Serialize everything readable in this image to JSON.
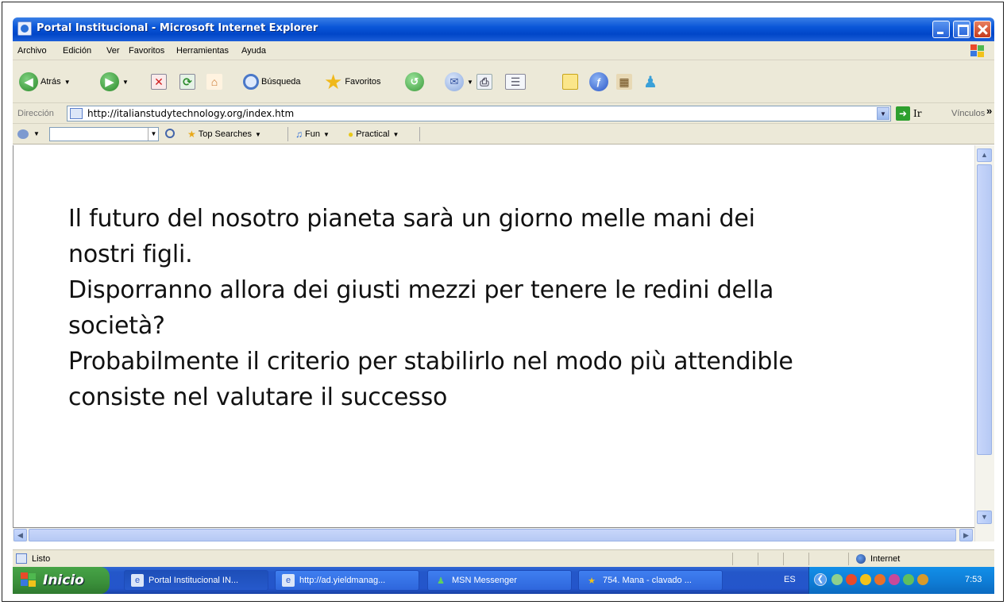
{
  "window": {
    "title": "Portal Institucional  - Microsoft Internet Explorer"
  },
  "menu": {
    "items": [
      "Archivo",
      "Edición",
      "Ver",
      "Favoritos",
      "Herramientas",
      "Ayuda"
    ]
  },
  "toolbar": {
    "back_label": "Atrás",
    "search_label": "Búsqueda",
    "favorites_label": "Favoritos"
  },
  "address": {
    "label": "Dirección",
    "url": "http://italianstudytechnology.org/index.htm",
    "go_label": "Ir",
    "links_label": "Vínculos"
  },
  "linksbar": {
    "top_searches": "Top Searches",
    "fun": "Fun",
    "practical": "Practical"
  },
  "page": {
    "lines": [
      "Il futuro del nosotro pianeta sarà un giorno melle mani dei",
      "nostri figli.",
      "Disporranno allora dei giusti mezzi per tenere le redini della",
      "società?",
      "Probabilmente il criterio per stabilirlo nel modo più attendible",
      "consiste nel valutare il successo"
    ]
  },
  "status": {
    "text": "Listo",
    "zone": "Internet"
  },
  "taskbar": {
    "start_label": "Inicio",
    "tasks": [
      "Portal Institucional IN...",
      "http://ad.yieldmanag...",
      "MSN Messenger",
      "754. Mana - clavado ..."
    ],
    "language": "ES",
    "clock": "7:53"
  },
  "colors": {
    "titlebar": "#0a56d8",
    "chrome": "#ece9d8",
    "taskbar": "#2457c9",
    "start": "#3a8f3a"
  },
  "icons": [
    "back-icon",
    "forward-icon",
    "stop-icon",
    "refresh-icon",
    "home-icon",
    "search-icon",
    "favorites-star-icon",
    "history-icon",
    "mail-icon",
    "print-icon",
    "edit-icon",
    "note-icon",
    "messenger-icon",
    "go-arrow-icon",
    "globe-icon"
  ]
}
